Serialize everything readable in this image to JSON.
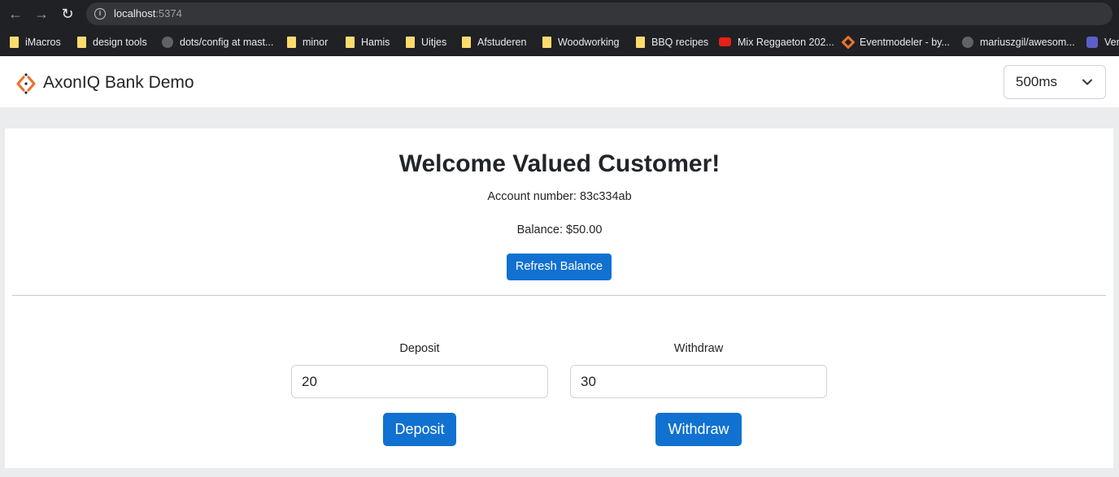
{
  "browser": {
    "url_host": "localhost",
    "url_port": ":5374",
    "bookmarks": [
      {
        "label": "iMacros",
        "icon": "folder-icon"
      },
      {
        "label": "design tools",
        "icon": "folder-icon"
      },
      {
        "label": "dots/config at mast...",
        "icon": "github-icon"
      },
      {
        "label": "minor",
        "icon": "folder-icon"
      },
      {
        "label": "Hamis",
        "icon": "folder-icon"
      },
      {
        "label": "Uitjes",
        "icon": "folder-icon"
      },
      {
        "label": "Afstuderen",
        "icon": "folder-icon"
      },
      {
        "label": "Woodworking",
        "icon": "folder-icon"
      },
      {
        "label": "BBQ recipes",
        "icon": "folder-icon"
      },
      {
        "label": "Mix Reggaeton 202...",
        "icon": "youtube-icon"
      },
      {
        "label": "Eventmodeler - by...",
        "icon": "eventmodeler-icon"
      },
      {
        "label": "mariuszgil/awesom...",
        "icon": "github-icon"
      },
      {
        "label": "Ver",
        "icon": "teams-icon"
      }
    ]
  },
  "app": {
    "title": "AxonIQ Bank Demo",
    "delay_select": "500ms"
  },
  "main": {
    "welcome": "Welcome Valued Customer!",
    "account_number": "Account number: 83c334ab",
    "balance": "Balance: $50.00",
    "refresh_label": "Refresh Balance",
    "deposit_label": "Deposit",
    "deposit_value": "20",
    "deposit_button": "Deposit",
    "withdraw_label": "Withdraw",
    "withdraw_value": "30",
    "withdraw_button": "Withdraw"
  },
  "colors": {
    "primary": "#1071d1",
    "logo_orange": "#e8742a"
  }
}
